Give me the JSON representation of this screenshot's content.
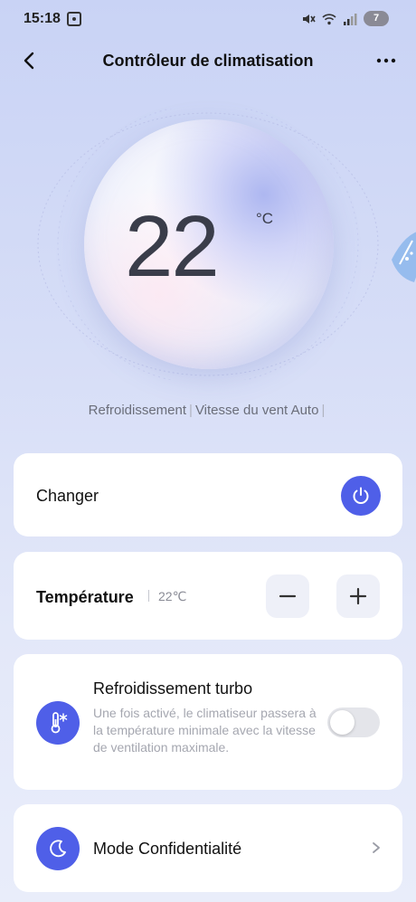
{
  "status_bar": {
    "time": "15:18",
    "battery": "7",
    "icons": [
      "screen-record-icon",
      "mute-icon",
      "wifi-icon",
      "signal-icon",
      "battery-icon"
    ]
  },
  "header": {
    "title": "Contrôleur de climatisation",
    "back_icon": "chevron-left-icon",
    "more_icon": "more-dots-icon"
  },
  "dial": {
    "temperature": "22",
    "unit": "°C"
  },
  "mode_line": {
    "mode": "Refroidissement",
    "fan": "Vitesse du vent Auto",
    "separator": "|"
  },
  "power_card": {
    "label": "Changer",
    "icon": "power-icon",
    "accent": "#4f5fe8"
  },
  "temperature_card": {
    "label": "Température",
    "value": "22℃",
    "minus_icon": "minus-icon",
    "plus_icon": "plus-icon"
  },
  "turbo_card": {
    "title": "Refroidissement turbo",
    "description": "Une fois activé, le climatiseur passera à la température minimale avec la vitesse de ventilation maximale.",
    "icon": "thermometer-snow-icon",
    "enabled": false
  },
  "privacy_card": {
    "label": "Mode Confidentialité",
    "icon": "moon-icon",
    "chevron": "chevron-right-icon"
  }
}
